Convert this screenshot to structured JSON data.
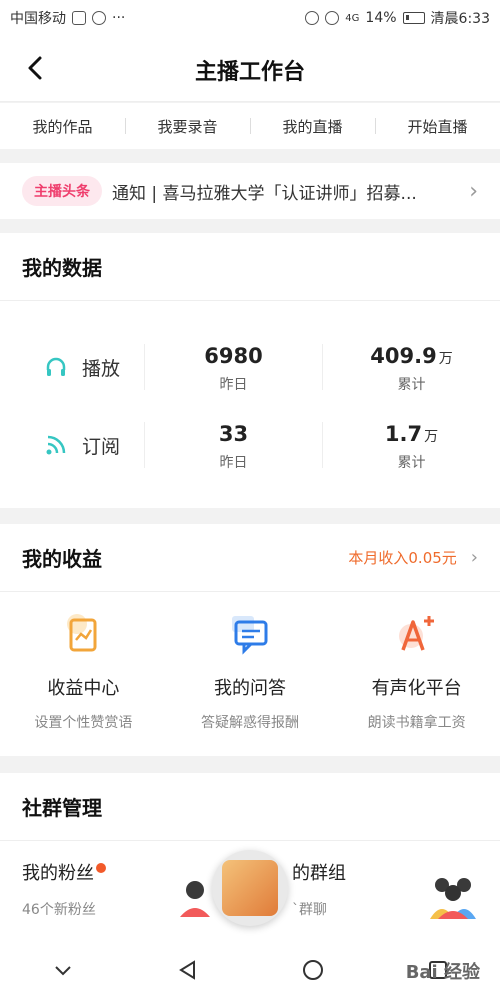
{
  "status_bar": {
    "carrier": "中国移动",
    "network": "4G",
    "battery": "14%",
    "time": "清晨6:33"
  },
  "nav": {
    "title": "主播工作台"
  },
  "quick_tabs": [
    "我的作品",
    "我要录音",
    "我的直播",
    "开始直播"
  ],
  "notice": {
    "badge": "主播头条",
    "text": "通知 | 喜马拉雅大学「认证讲师」招募..."
  },
  "my_data": {
    "title": "我的数据",
    "rows": [
      {
        "label": "播放",
        "icon": "headphones-icon",
        "daily": "6980",
        "daily_label": "昨日",
        "total": "409.9",
        "total_unit": "万",
        "total_label": "累计"
      },
      {
        "label": "订阅",
        "icon": "rss-icon",
        "daily": "33",
        "daily_label": "昨日",
        "total": "1.7",
        "total_unit": "万",
        "total_label": "累计"
      }
    ]
  },
  "earnings": {
    "title": "我的收益",
    "link": "本月收入0.05元",
    "items": [
      {
        "name": "收益中心",
        "desc": "设置个性赞赏语",
        "icon": "revenue-icon"
      },
      {
        "name": "我的问答",
        "desc": "答疑解惑得报酬",
        "icon": "qa-icon"
      },
      {
        "name": "有声化平台",
        "desc": "朗读书籍拿工资",
        "icon": "audio-platform-icon"
      }
    ]
  },
  "community": {
    "title": "社群管理",
    "items": [
      {
        "name": "我的粉丝",
        "sub": "46个新粉丝",
        "icon": "fans-avatar-icon"
      },
      {
        "name": "的群组",
        "sub": "`群聊",
        "icon": "group-avatar-icon"
      }
    ]
  },
  "watermark": "Bai 经验",
  "colors": {
    "accent": "#ef6b2c",
    "badge_text": "#ef3e6d",
    "badge_bg": "#fde8ee",
    "teal": "#36c6c2",
    "blue": "#2e7ce8"
  }
}
